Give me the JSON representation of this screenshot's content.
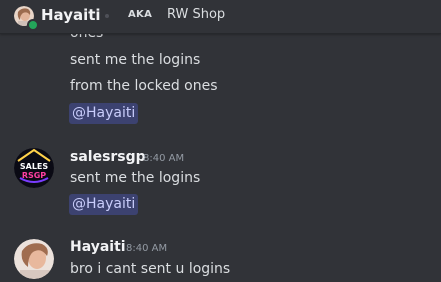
{
  "header": {
    "username": "Hayaiti",
    "aka_label": "AKA",
    "alias": "RW Shop",
    "status_color": "#23a55a",
    "avatar_icon": "user-avatar"
  },
  "messages": [
    {
      "lines": [
        "ones",
        "sent me the logins",
        "from the locked ones"
      ],
      "mention": "@Hayaiti"
    },
    {
      "author": "salesrsgp",
      "time": "8:40 AM",
      "avatar_top": "SALES",
      "avatar_bottom": "RSGP",
      "lines": [
        "sent me the logins"
      ],
      "mention": "@Hayaiti"
    },
    {
      "author": "Hayaiti",
      "time": "8:40 AM",
      "lines": [
        "bro i cant sent u logins"
      ]
    }
  ],
  "colors": {
    "background": "#313338",
    "mention_bg": "#3c4270",
    "mention_text": "#c9cdfb",
    "text": "#dbdee1",
    "timestamp": "#949ba4"
  }
}
